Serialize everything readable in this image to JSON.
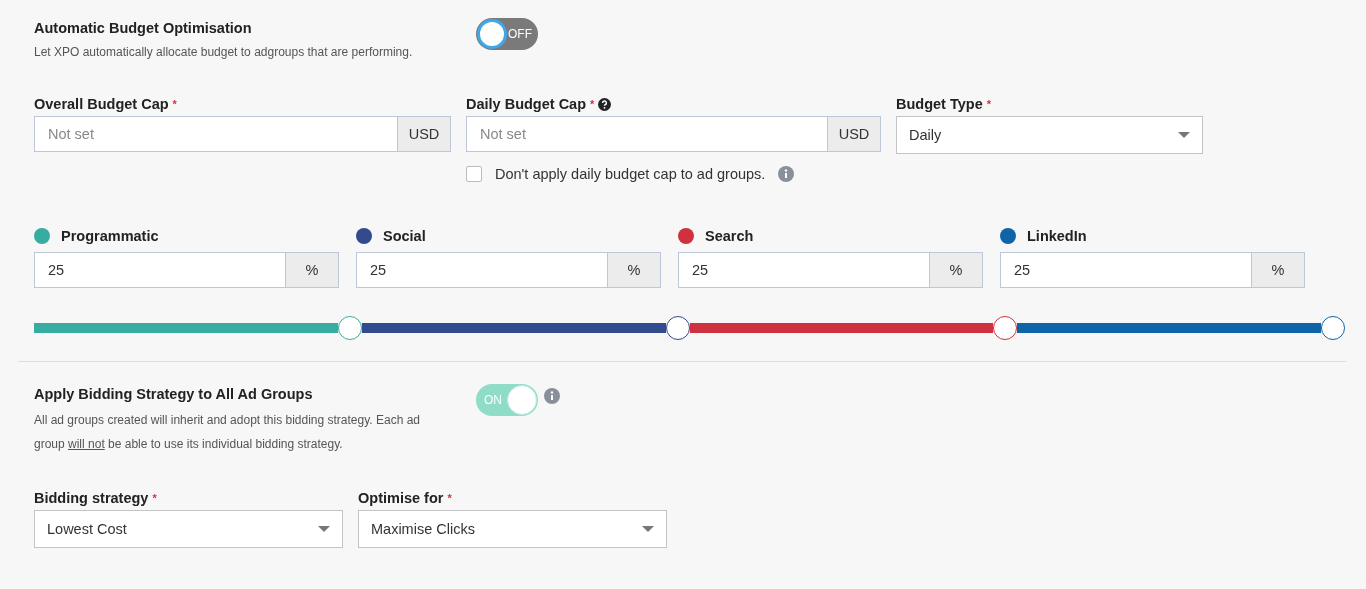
{
  "auto_budget": {
    "title": "Automatic Budget Optimisation",
    "description": "Let XPO automatically allocate budget to adgroups that are performing.",
    "toggle": {
      "on": false,
      "label": "OFF"
    }
  },
  "budget_fields": [
    {
      "kind": "currency",
      "label": "Overall Budget Cap",
      "required_mark": "*",
      "help": false,
      "placeholder": "Not set",
      "unit": "USD"
    },
    {
      "kind": "currency",
      "label": "Daily Budget Cap",
      "required_mark": "*",
      "help": true,
      "placeholder": "Not set",
      "unit": "USD"
    },
    {
      "kind": "select",
      "label": "Budget Type",
      "required_mark": "*",
      "help": false,
      "value": "Daily"
    }
  ],
  "daily_cap_checkbox": {
    "label": "Don't apply daily budget cap to ad groups.",
    "checked": false
  },
  "channels": [
    {
      "name": "Programmatic",
      "color": "#36ada0",
      "value": "25",
      "unit": "%"
    },
    {
      "name": "Social",
      "color": "#314b8c",
      "value": "25",
      "unit": "%"
    },
    {
      "name": "Search",
      "color": "#d0313f",
      "value": "25",
      "unit": "%"
    },
    {
      "name": "LinkedIn",
      "color": "#0f64a8",
      "value": "25",
      "unit": "%"
    }
  ],
  "bidding": {
    "title": "Apply Bidding Strategy to All Ad Groups",
    "toggle": {
      "on": true,
      "label": "ON"
    },
    "description_parts": [
      {
        "text": "All ad groups created will inherit and adopt this bidding strategy. Each ad group ",
        "underlined": false
      },
      {
        "text": "will not",
        "underlined": true
      },
      {
        "text": " be able to use its individual bidding strategy.",
        "underlined": false
      }
    ]
  },
  "bidding_fields": [
    {
      "label": "Bidding strategy",
      "required_mark": "*",
      "value": "Lowest Cost"
    },
    {
      "label": "Optimise for",
      "required_mark": "*",
      "value": "Maximise Clicks"
    }
  ]
}
